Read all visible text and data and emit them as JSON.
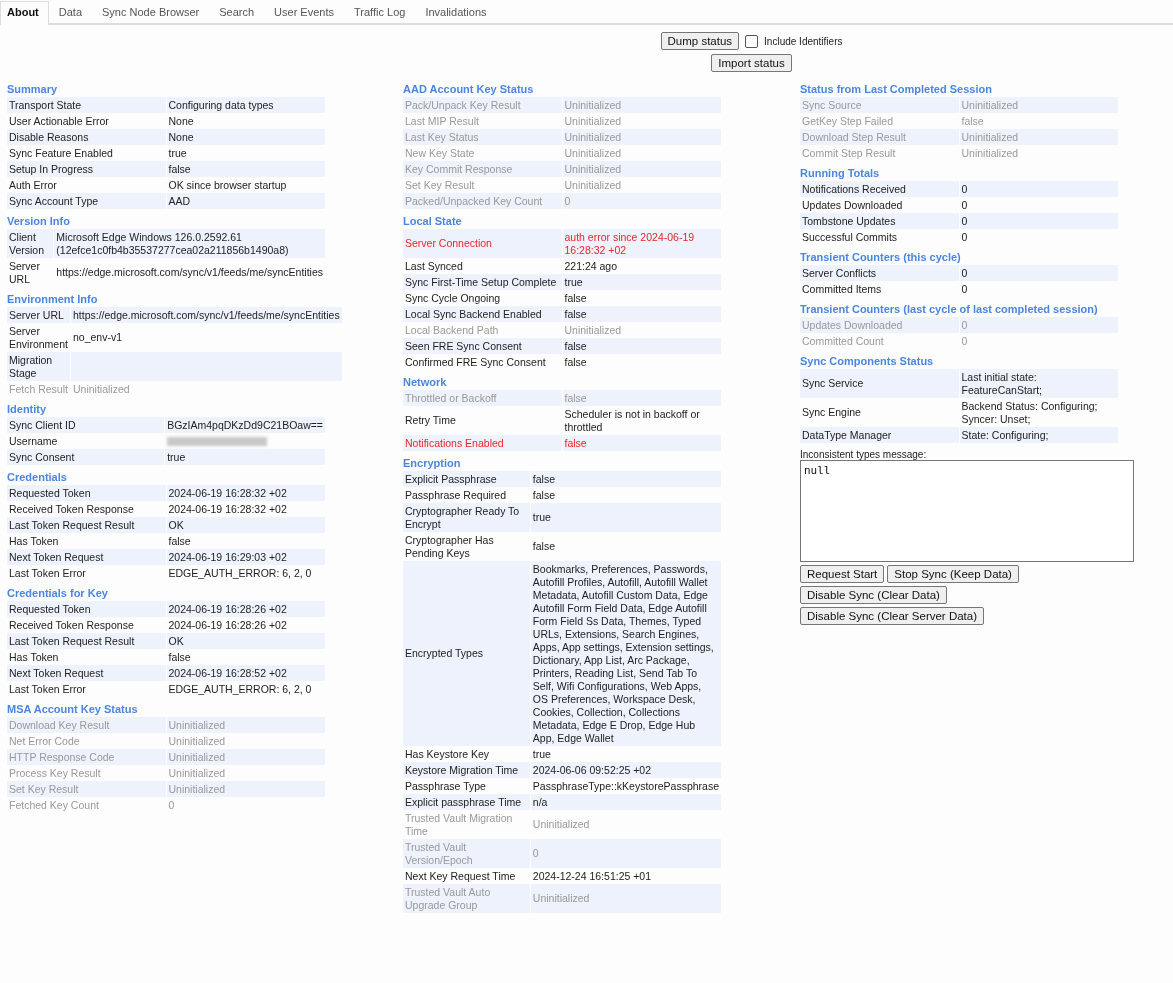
{
  "tabs": [
    {
      "label": "About",
      "selected": true
    },
    {
      "label": "Data",
      "selected": false
    },
    {
      "label": "Sync Node Browser",
      "selected": false
    },
    {
      "label": "Search",
      "selected": false
    },
    {
      "label": "User Events",
      "selected": false
    },
    {
      "label": "Traffic Log",
      "selected": false
    },
    {
      "label": "Invalidations",
      "selected": false
    }
  ],
  "toolbar": {
    "dump_button": "Dump status",
    "include_identifiers": {
      "label": "Include Identifiers",
      "checked": false
    },
    "import_button": "Import status"
  },
  "columns": [
    {
      "sections": [
        {
          "title": "Summary",
          "rows": [
            {
              "label": "Transport State",
              "value": "Configuring data types",
              "kind": "normal"
            },
            {
              "label": "User Actionable Error",
              "value": "None",
              "kind": "normal"
            },
            {
              "label": "Disable Reasons",
              "value": "None",
              "kind": "normal"
            },
            {
              "label": "Sync Feature Enabled",
              "value": "true",
              "kind": "normal"
            },
            {
              "label": "Setup In Progress",
              "value": "false",
              "kind": "normal"
            },
            {
              "label": "Auth Error",
              "value": "OK since browser startup",
              "kind": "normal"
            },
            {
              "label": "Sync Account Type",
              "value": "AAD",
              "kind": "normal"
            }
          ]
        },
        {
          "title": "Version Info",
          "rows": [
            {
              "label": "Client Version",
              "value": "Microsoft Edge Windows 126.0.2592.61 (12efce1c0fb4b35537277cea02a211856b1490a8)",
              "kind": "normal"
            },
            {
              "label": "Server URL",
              "value": "https://edge.microsoft.com/sync/v1/feeds/me/syncEntities",
              "kind": "normal"
            }
          ]
        },
        {
          "title": "Environment Info",
          "rows": [
            {
              "label": "Server URL",
              "value": "https://edge.microsoft.com/sync/v1/feeds/me/syncEntities",
              "kind": "normal"
            },
            {
              "label": "Server Environment",
              "value": "no_env-v1",
              "kind": "normal"
            },
            {
              "label": "Migration Stage",
              "value": "",
              "kind": "normal"
            },
            {
              "label": "Fetch Result",
              "value": "Uninitialized",
              "kind": "uninitialized"
            }
          ]
        },
        {
          "title": "Identity",
          "rows": [
            {
              "label": "Sync Client ID",
              "value": "BGzIAm4pqDKzDd9C21BOaw==",
              "kind": "normal"
            },
            {
              "label": "Username",
              "kind": "redacted"
            },
            {
              "label": "Sync Consent",
              "value": "true",
              "kind": "normal"
            }
          ]
        },
        {
          "title": "Credentials",
          "rows": [
            {
              "label": "Requested Token",
              "value": "2024-06-19 16:28:32 +02",
              "kind": "normal"
            },
            {
              "label": "Received Token Response",
              "value": "2024-06-19 16:28:32 +02",
              "kind": "normal"
            },
            {
              "label": "Last Token Request Result",
              "value": "OK",
              "kind": "normal"
            },
            {
              "label": "Has Token",
              "value": "false",
              "kind": "normal"
            },
            {
              "label": "Next Token Request",
              "value": "2024-06-19 16:29:03 +02",
              "kind": "normal"
            },
            {
              "label": "Last Token Error",
              "value": "EDGE_AUTH_ERROR: 6, 2, 0",
              "kind": "normal"
            }
          ]
        },
        {
          "title": "Credentials for Key",
          "rows": [
            {
              "label": "Requested Token",
              "value": "2024-06-19 16:28:26 +02",
              "kind": "normal"
            },
            {
              "label": "Received Token Response",
              "value": "2024-06-19 16:28:26 +02",
              "kind": "normal"
            },
            {
              "label": "Last Token Request Result",
              "value": "OK",
              "kind": "normal"
            },
            {
              "label": "Has Token",
              "value": "false",
              "kind": "normal"
            },
            {
              "label": "Next Token Request",
              "value": "2024-06-19 16:28:52 +02",
              "kind": "normal"
            },
            {
              "label": "Last Token Error",
              "value": "EDGE_AUTH_ERROR: 6, 2, 0",
              "kind": "normal"
            }
          ]
        },
        {
          "title": "MSA Account Key Status",
          "rows": [
            {
              "label": "Download Key Result",
              "value": "Uninitialized",
              "kind": "uninitialized"
            },
            {
              "label": "Net Error Code",
              "value": "Uninitialized",
              "kind": "uninitialized"
            },
            {
              "label": "HTTP Response Code",
              "value": "Uninitialized",
              "kind": "uninitialized"
            },
            {
              "label": "Process Key Result",
              "value": "Uninitialized",
              "kind": "uninitialized"
            },
            {
              "label": "Set Key Result",
              "value": "Uninitialized",
              "kind": "uninitialized"
            },
            {
              "label": "Fetched Key Count",
              "value": "0",
              "kind": "uninitialized"
            }
          ]
        }
      ]
    },
    {
      "sections": [
        {
          "title": "AAD Account Key Status",
          "rows": [
            {
              "label": "Pack/Unpack Key Result",
              "value": "Uninitialized",
              "kind": "uninitialized"
            },
            {
              "label": "Last MIP Result",
              "value": "Uninitialized",
              "kind": "uninitialized"
            },
            {
              "label": "Last Key Status",
              "value": "Uninitialized",
              "kind": "uninitialized"
            },
            {
              "label": "New Key State",
              "value": "Uninitialized",
              "kind": "uninitialized"
            },
            {
              "label": "Key Commit Response",
              "value": "Uninitialized",
              "kind": "uninitialized"
            },
            {
              "label": "Set Key Result",
              "value": "Uninitialized",
              "kind": "uninitialized"
            },
            {
              "label": "Packed/Unpacked Key Count",
              "value": "0",
              "kind": "uninitialized"
            }
          ]
        },
        {
          "title": "Local State",
          "rows": [
            {
              "label": "Server Connection",
              "value": "auth error since 2024-06-19 16:28:32 +02",
              "kind": "error"
            },
            {
              "label": "Last Synced",
              "value": "221:24 ago",
              "kind": "normal"
            },
            {
              "label": "Sync First-Time Setup Complete",
              "value": "true",
              "kind": "normal"
            },
            {
              "label": "Sync Cycle Ongoing",
              "value": "false",
              "kind": "normal"
            },
            {
              "label": "Local Sync Backend Enabled",
              "value": "false",
              "kind": "normal"
            },
            {
              "label": "Local Backend Path",
              "value": "Uninitialized",
              "kind": "uninitialized"
            },
            {
              "label": "Seen FRE Sync Consent",
              "value": "false",
              "kind": "normal"
            },
            {
              "label": "Confirmed FRE Sync Consent",
              "value": "false",
              "kind": "normal"
            }
          ]
        },
        {
          "title": "Network",
          "rows": [
            {
              "label": "Throttled or Backoff",
              "value": "false",
              "kind": "uninitialized"
            },
            {
              "label": "Retry Time",
              "value": "Scheduler is not in backoff or throttled",
              "kind": "normal"
            },
            {
              "label": "Notifications Enabled",
              "value": "false",
              "kind": "error"
            }
          ]
        },
        {
          "title": "Encryption",
          "rows": [
            {
              "label": "Explicit Passphrase",
              "value": "false",
              "kind": "normal"
            },
            {
              "label": "Passphrase Required",
              "value": "false",
              "kind": "normal"
            },
            {
              "label": "Cryptographer Ready To Encrypt",
              "value": "true",
              "kind": "normal"
            },
            {
              "label": "Cryptographer Has Pending Keys",
              "value": "false",
              "kind": "normal"
            },
            {
              "label": "Encrypted Types",
              "value": "Bookmarks, Preferences, Passwords, Autofill Profiles, Autofill, Autofill Wallet Metadata, Autofill Custom Data, Edge Autofill Form Field Data, Edge Autofill Form Field Ss Data, Themes, Typed URLs, Extensions, Search Engines, Apps, App settings, Extension settings, Dictionary, App List, Arc Package, Printers, Reading List, Send Tab To Self, Wifi Configurations, Web Apps, OS Preferences, Workspace Desk, Cookies, Collection, Collections Metadata, Edge E Drop, Edge Hub App, Edge Wallet",
              "kind": "normal"
            },
            {
              "label": "Has Keystore Key",
              "value": "true",
              "kind": "normal"
            },
            {
              "label": "Keystore Migration Time",
              "value": "2024-06-06 09:52:25 +02",
              "kind": "normal"
            },
            {
              "label": "Passphrase Type",
              "value": "PassphraseType::kKeystorePassphrase",
              "kind": "normal"
            },
            {
              "label": "Explicit passphrase Time",
              "value": "n/a",
              "kind": "normal"
            },
            {
              "label": "Trusted Vault Migration Time",
              "value": "Uninitialized",
              "kind": "uninitialized"
            },
            {
              "label": "Trusted Vault Version/Epoch",
              "value": "0",
              "kind": "uninitialized"
            },
            {
              "label": "Next Key Request Time",
              "value": "2024-12-24 16:51:25 +01",
              "kind": "normal"
            },
            {
              "label": "Trusted Vault Auto Upgrade Group",
              "value": "Uninitialized",
              "kind": "uninitialized"
            }
          ]
        }
      ]
    },
    {
      "sections": [
        {
          "title": "Status from Last Completed Session",
          "rows": [
            {
              "label": "Sync Source",
              "value": "Uninitialized",
              "kind": "uninitialized"
            },
            {
              "label": "GetKey Step Failed",
              "value": "false",
              "kind": "uninitialized"
            },
            {
              "label": "Download Step Result",
              "value": "Uninitialized",
              "kind": "uninitialized"
            },
            {
              "label": "Commit Step Result",
              "value": "Uninitialized",
              "kind": "uninitialized"
            }
          ]
        },
        {
          "title": "Running Totals",
          "rows": [
            {
              "label": "Notifications Received",
              "value": "0",
              "kind": "normal"
            },
            {
              "label": "Updates Downloaded",
              "value": "0",
              "kind": "normal"
            },
            {
              "label": "Tombstone Updates",
              "value": "0",
              "kind": "normal"
            },
            {
              "label": "Successful Commits",
              "value": "0",
              "kind": "normal"
            }
          ]
        },
        {
          "title": "Transient Counters (this cycle)",
          "rows": [
            {
              "label": "Server Conflicts",
              "value": "0",
              "kind": "normal"
            },
            {
              "label": "Committed Items",
              "value": "0",
              "kind": "normal"
            }
          ]
        },
        {
          "title": "Transient Counters (last cycle of last completed session)",
          "rows": [
            {
              "label": "Updates Downloaded",
              "value": "0",
              "kind": "uninitialized"
            },
            {
              "label": "Committed Count",
              "value": "0",
              "kind": "uninitialized"
            }
          ]
        },
        {
          "title": "Sync Components Status",
          "rows": [
            {
              "label": "Sync Service",
              "value": "Last initial state: FeatureCanStart;",
              "kind": "normal"
            },
            {
              "label": "Sync Engine",
              "value": "Backend Status: Configuring; Syncer: Unset;",
              "kind": "normal"
            },
            {
              "label": "DataType Manager",
              "value": "State: Configuring;",
              "kind": "normal"
            }
          ]
        }
      ]
    }
  ],
  "inconsistent_types": {
    "label": "Inconsistent types message:",
    "value": "null"
  },
  "action_rows": [
    [
      "Request Start",
      "Stop Sync (Keep Data)"
    ],
    [
      "Disable Sync (Clear Data)"
    ],
    [
      "Disable Sync (Clear Server Data)"
    ]
  ]
}
